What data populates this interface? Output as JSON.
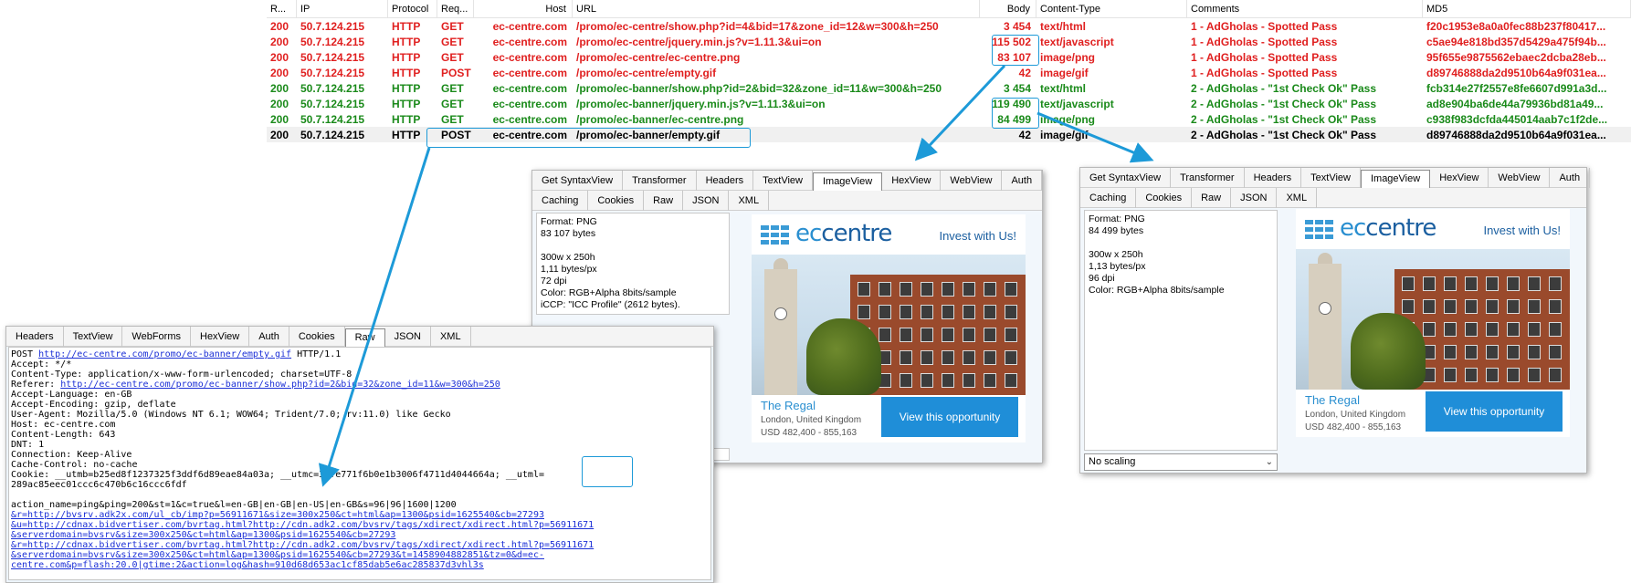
{
  "grid": {
    "columns": [
      "R...",
      "IP",
      "Protocol",
      "Req...",
      "Host",
      "URL",
      "Body",
      "Content-Type",
      "Comments",
      "MD5"
    ],
    "rows": [
      {
        "color": "red",
        "result": "200",
        "ip": "50.7.124.215",
        "protocol": "HTTP",
        "method": "GET",
        "host": "ec-centre.com",
        "url": "/promo/ec-centre/show.php?id=4&bid=17&zone_id=12&w=300&h=250",
        "body": "3 454",
        "content_type": "text/html",
        "comments": "1 - AdGholas - Spotted Pass",
        "md5": "f20c1953e8a0a0fec88b237f80417..."
      },
      {
        "color": "red",
        "result": "200",
        "ip": "50.7.124.215",
        "protocol": "HTTP",
        "method": "GET",
        "host": "ec-centre.com",
        "url": "/promo/ec-centre/jquery.min.js?v=1.11.3&ui=on",
        "body": "115 502",
        "content_type": "text/javascript",
        "comments": "1 - AdGholas - Spotted Pass",
        "md5": "c5ae94e818bd357d5429a475f94b..."
      },
      {
        "color": "red",
        "result": "200",
        "ip": "50.7.124.215",
        "protocol": "HTTP",
        "method": "GET",
        "host": "ec-centre.com",
        "url": "/promo/ec-centre/ec-centre.png",
        "body": "83 107",
        "content_type": "image/png",
        "comments": "1 - AdGholas - Spotted Pass",
        "md5": "95f655e9875562ebaec2dcba28eb..."
      },
      {
        "color": "red",
        "result": "200",
        "ip": "50.7.124.215",
        "protocol": "HTTP",
        "method": "POST",
        "host": "ec-centre.com",
        "url": "/promo/ec-centre/empty.gif",
        "body": "42",
        "content_type": "image/gif",
        "comments": "1 - AdGholas - Spotted Pass",
        "md5": "d89746888da2d9510b64a9f031ea..."
      },
      {
        "color": "green",
        "result": "200",
        "ip": "50.7.124.215",
        "protocol": "HTTP",
        "method": "GET",
        "host": "ec-centre.com",
        "url": "/promo/ec-banner/show.php?id=2&bid=32&zone_id=11&w=300&h=250",
        "body": "3 454",
        "content_type": "text/html",
        "comments": "2 - AdGholas - \"1st Check Ok\" Pass",
        "md5": "fcb314e27f2557e8fe6607d991a3d..."
      },
      {
        "color": "green",
        "result": "200",
        "ip": "50.7.124.215",
        "protocol": "HTTP",
        "method": "GET",
        "host": "ec-centre.com",
        "url": "/promo/ec-banner/jquery.min.js?v=1.11.3&ui=on",
        "body": "119 490",
        "content_type": "text/javascript",
        "comments": "2 - AdGholas - \"1st Check Ok\" Pass",
        "md5": "ad8e904ba6de44a79936bd81a49..."
      },
      {
        "color": "green",
        "result": "200",
        "ip": "50.7.124.215",
        "protocol": "HTTP",
        "method": "GET",
        "host": "ec-centre.com",
        "url": "/promo/ec-banner/ec-centre.png",
        "body": "84 499",
        "content_type": "image/png",
        "comments": "2 - AdGholas - \"1st Check Ok\" Pass",
        "md5": "c938f983dcfda445014aab7c1f2de..."
      },
      {
        "color": "black",
        "result": "200",
        "ip": "50.7.124.215",
        "protocol": "HTTP",
        "method": "POST",
        "host": "ec-centre.com",
        "url": "/promo/ec-banner/empty.gif",
        "body": "42",
        "content_type": "image/gif",
        "comments": "2 - AdGholas - \"1st Check Ok\" Pass",
        "md5": "d89746888da2d9510b64a9f031ea..."
      }
    ]
  },
  "image_view_1": {
    "tabs_row1": [
      "Get SyntaxView",
      "Transformer",
      "Headers",
      "TextView",
      "ImageView",
      "HexView",
      "WebView",
      "Auth"
    ],
    "tabs_row2": [
      "Caching",
      "Cookies",
      "Raw",
      "JSON",
      "XML"
    ],
    "active_tab": "ImageView",
    "meta": [
      "Format: PNG",
      "83 107 bytes",
      "",
      "300w x 250h",
      "1,11 bytes/px",
      "72 dpi",
      "Color: RGB+Alpha 8bits/sample",
      "iCCP: \"ICC Profile\" (2612 bytes)."
    ]
  },
  "image_view_2": {
    "tabs_row1": [
      "Get SyntaxView",
      "Transformer",
      "Headers",
      "TextView",
      "ImageView",
      "HexView",
      "WebView",
      "Auth"
    ],
    "tabs_row2": [
      "Caching",
      "Cookies",
      "Raw",
      "JSON",
      "XML"
    ],
    "active_tab": "ImageView",
    "meta": [
      "Format: PNG",
      "84 499 bytes",
      "",
      "300w x 250h",
      "1,13 bytes/px",
      "96 dpi",
      "Color: RGB+Alpha 8bits/sample"
    ],
    "scaling": "No scaling"
  },
  "banner": {
    "brand_prefix": "ec",
    "brand_suffix": "centre",
    "invest": "Invest",
    "invest_tail": "with Us!",
    "place": "The Regal",
    "city": "London, United Kingdom",
    "price": "USD 482,400 - 855,163",
    "cta": "View this opportunity"
  },
  "request_inspector": {
    "tabs": [
      "Headers",
      "TextView",
      "WebForms",
      "HexView",
      "Auth",
      "Cookies",
      "Raw",
      "JSON",
      "XML"
    ],
    "active_tab": "Raw",
    "lines": [
      {
        "text": "POST ",
        "link": "http://ec-centre.com/promo/ec-banner/empty.gif",
        "tail": " HTTP/1.1"
      },
      {
        "text": "Accept: */*"
      },
      {
        "text": "Content-Type: application/x-www-form-urlencoded; charset=UTF-8"
      },
      {
        "text": "Referer: ",
        "link": "http://ec-centre.com/promo/ec-banner/show.php?id=2&bid=32&zone_id=11&w=300&h=250"
      },
      {
        "text": "Accept-Language: en-GB"
      },
      {
        "text": "Accept-Encoding: gzip, deflate"
      },
      {
        "text": "User-Agent: Mozilla/5.0 (Windows NT 6.1; WOW64; Trident/7.0; rv:11.0) like Gecko"
      },
      {
        "text": "Host: ec-centre.com"
      },
      {
        "text": "Content-Length: 643"
      },
      {
        "text": "DNT: 1"
      },
      {
        "text": "Connection: Keep-Alive"
      },
      {
        "text": "Cache-Control: no-cache"
      },
      {
        "text": "Cookie: __utmb=b25ed8f1237325f3ddf6d89eae84a03a; __utmc=3afe771f6b0e1b3006f4711d4044664a; __utml="
      },
      {
        "text": "289ac85eec01ccc6c470b6c16ccc6fdf"
      },
      {
        "text": ""
      },
      {
        "text": "action_name=ping&ping=200&st=1&c=true&l=en-GB|en-GB|en-US|en-GB&s=96|96|1600|1200"
      },
      {
        "text": "",
        "link": "&r=http://bvsrv.adk2x.com/ul_cb/imp?p=56911671&size=300x250&ct=html&ap=1300&psid=1625540&cb=27293"
      },
      {
        "text": "",
        "link": "&u=http://cdnax.bidvertiser.com/bvrtag.html?http://cdn.adk2.com/bvsrv/tags/xdirect/xdirect.html?p=56911671"
      },
      {
        "text": "",
        "link": "&serverdomain=bvsrv&size=300x250&ct=html&ap=1300&psid=1625540&cb=27293"
      },
      {
        "text": "",
        "link": "&r=http://cdnax.bidvertiser.com/bvrtag.html?http://cdn.adk2.com/bvsrv/tags/xdirect/xdirect.html?p=56911671"
      },
      {
        "text": "",
        "link": "&serverdomain=bvsrv&size=300x250&ct=html&ap=1300&psid=1625540&cb=27293&t=1458904882851&tz=0&d=ec-"
      },
      {
        "text": "",
        "link": "centre.com&p=flash:20.0|gtime:2&action=log&hash=910d68d653ac1cf85dab5e6ac285837d3vhl3s"
      }
    ]
  },
  "colors": {
    "red": "#e02020",
    "green": "#1a8a1a",
    "accent": "#1d9ad8"
  }
}
